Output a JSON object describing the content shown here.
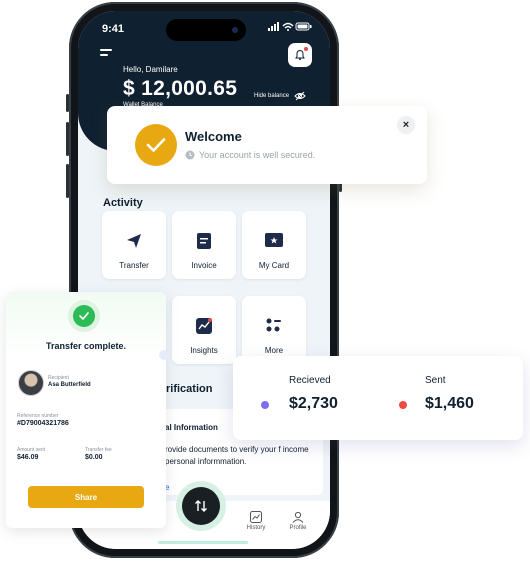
{
  "status": {
    "time": "9:41"
  },
  "header": {
    "greeting": "Hello, Damilare",
    "balance": "$ 12,000.65",
    "balance_label": "Wallet Balance",
    "hide_balance_label": "Hide balance"
  },
  "activity": {
    "title": "Activity",
    "tiles": [
      {
        "label": "Transfer",
        "icon": "send-icon"
      },
      {
        "label": "Invoice",
        "icon": "invoice-icon"
      },
      {
        "label": "My Card",
        "icon": "card-icon"
      },
      {
        "label": "Insights",
        "icon": "insights-icon"
      },
      {
        "label": "More",
        "icon": "more-icon"
      }
    ]
  },
  "verification": {
    "title_partial": "rification",
    "card_title": "al Information",
    "card_text": "rovide documents to verify your f income personal informmation.",
    "link_text": "e"
  },
  "bottom_nav": {
    "items": [
      {
        "label": "History",
        "icon": "history-icon"
      },
      {
        "label": "Profile",
        "icon": "profile-icon"
      }
    ],
    "fab_icon": "transfer-arrows-icon"
  },
  "welcome_popup": {
    "title": "Welcome",
    "subtitle": "Your account is well secured.",
    "close_label": "×"
  },
  "transfer_card": {
    "title": "Transfer complete.",
    "recipient_label": "Recipient",
    "recipient_name": "Asa Butterfield",
    "reference_label": "Reference number",
    "reference_value": "#D79004321786",
    "amount_label": "Amount sent",
    "amount_value": "$46.09",
    "fee_label": "Transfer fee",
    "fee_value": "$0.00",
    "share_label": "Share"
  },
  "stats": {
    "received_label": "Recieved",
    "received_value": "$2,730",
    "sent_label": "Sent",
    "sent_value": "$1,460",
    "received_color": "#7b6cf6",
    "sent_color": "#f04a3e"
  },
  "colors": {
    "accent": "#e8a812",
    "dark": "#0f2030",
    "success": "#2dbb55"
  }
}
